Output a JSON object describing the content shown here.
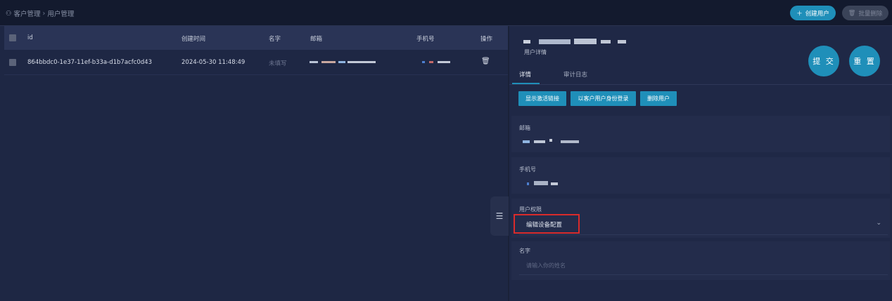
{
  "breadcrumb": {
    "parent": "客户管理",
    "current": "用户管理"
  },
  "header": {
    "create_label": "创建用户",
    "batch_delete_label": "批量删除"
  },
  "table": {
    "columns": [
      "id",
      "创建时间",
      "名字",
      "邮箱",
      "手机号",
      "操作"
    ],
    "rows": [
      {
        "id": "864bbdc0-1e37-11ef-b33a-d1b7acfc0d43",
        "created": "2024-05-30 11:48:49",
        "name": "未填写"
      }
    ]
  },
  "detail": {
    "subtitle": "用户详情",
    "submit_label": "提 交",
    "reset_label": "重 置",
    "tabs": [
      "详情",
      "审计日志"
    ],
    "actions": [
      "显示激活链接",
      "以客户用户身份登录",
      "删除用户"
    ],
    "email_label": "邮箱",
    "phone_label": "手机号",
    "permission_label": "用户权限",
    "permission_value": "编辑设备配置",
    "name_label": "名字",
    "name_placeholder": "请输入你的姓名"
  },
  "colors": {
    "accent": "#1f8fb9",
    "highlight": "#d92b2b",
    "background": "#1a2238"
  }
}
